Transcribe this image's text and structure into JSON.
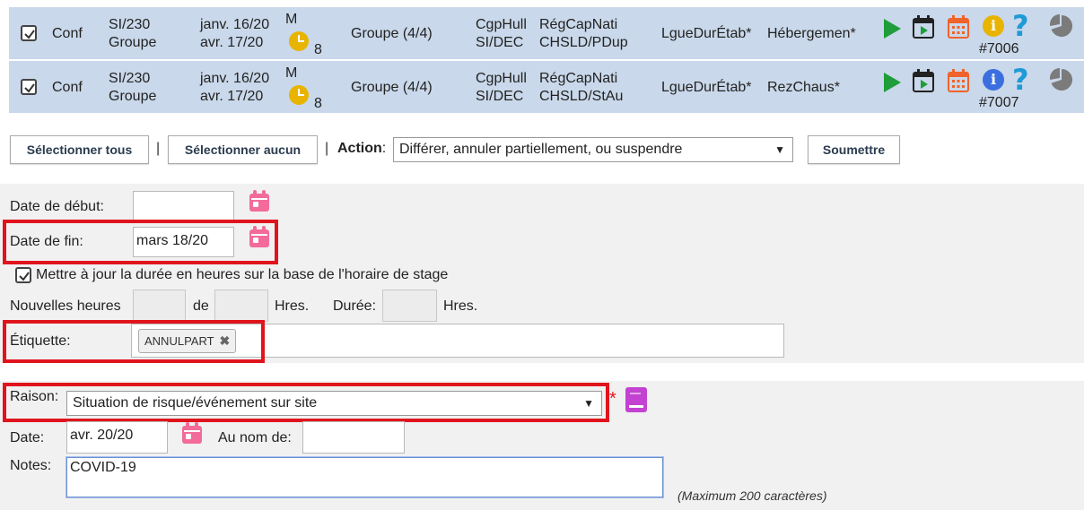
{
  "rows": [
    {
      "status": "Conf",
      "code": "SI/230",
      "group_label": "Groupe",
      "date_start": "janv. 16/20",
      "date_end": "avr. 17/20",
      "shift": "M",
      "hours_badge": "8",
      "group": "Groupe (4/4)",
      "institution": "CgpHull",
      "department": "SI/DEC",
      "region": "RégCapNati",
      "site": "CHSLD/PDup",
      "agreement": "LgueDurÉtab*",
      "unit": "Hébergemen*",
      "id": "#7006",
      "info_color": "#e8b400"
    },
    {
      "status": "Conf",
      "code": "SI/230",
      "group_label": "Groupe",
      "date_start": "janv. 16/20",
      "date_end": "avr. 17/20",
      "shift": "M",
      "hours_badge": "8",
      "group": "Groupe (4/4)",
      "institution": "CgpHull",
      "department": "SI/DEC",
      "region": "RégCapNati",
      "site": "CHSLD/StAu",
      "agreement": "LgueDurÉtab*",
      "unit": "RezChaus*",
      "id": "#7007",
      "info_color": "#3b6fe0"
    }
  ],
  "toolbar": {
    "select_all": "Sélectionner tous",
    "separator": "|",
    "select_none": "Sélectionner aucun",
    "action_label": "Action",
    "action_colon": ":",
    "action_value": "Différer, annuler partiellement, ou suspendre",
    "submit": "Soumettre"
  },
  "form": {
    "start_date_label": "Date de début:",
    "start_date_value": "",
    "end_date_label": "Date de fin:",
    "end_date_value": "mars 18/20",
    "update_hours_label": "Mettre à jour la durée en heures sur la base de l'horaire de stage",
    "update_hours_checked": true,
    "new_hours_label": "Nouvelles heures",
    "of_label": "de",
    "hrs_label_1": "Hres.",
    "duration_label": "Durée:",
    "hrs_label_2": "Hres.",
    "tag_label": "Étiquette:",
    "tag_value": "ANNULPART",
    "reason_label": "Raison:",
    "reason_value": "Situation de risque/événement sur site",
    "required_mark": "*",
    "date_label": "Date:",
    "date_value": "avr. 20/20",
    "on_behalf_label": "Au nom de:",
    "on_behalf_value": "",
    "notes_label": "Notes:",
    "notes_value": "COVID-19",
    "notes_hint": "(Maximum 200 caractères)"
  },
  "colors": {
    "row_bg": "#c9d8ea",
    "highlight": "#e0141c",
    "play_green": "#1f9d3a",
    "calendar_pink": "#f26b9a",
    "calendar_orange": "#f0632b",
    "help_blue": "#1e9ad6",
    "book_purple": "#c342d1"
  }
}
